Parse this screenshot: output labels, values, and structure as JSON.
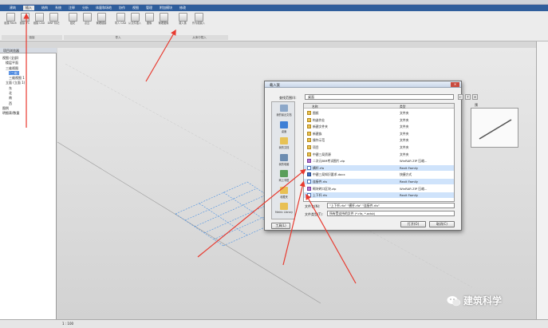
{
  "menubar": {
    "tabs": [
      "建筑",
      "插入",
      "结构",
      "系统",
      "注释",
      "分析",
      "体量和场地",
      "协作",
      "视图",
      "管理",
      "附加模块",
      "修改"
    ],
    "active_index": 1
  },
  "ribbon": {
    "buttons": [
      {
        "label": "链接 Revit"
      },
      {
        "label": "链接 IFC"
      },
      {
        "label": "链接 CAD"
      },
      {
        "label": "DWF 标记"
      },
      {
        "label": "贴花"
      },
      {
        "label": "点云"
      },
      {
        "label": "管理链接"
      },
      {
        "label": "导入 CAD"
      },
      {
        "label": "从文件插入"
      },
      {
        "label": "图像"
      },
      {
        "label": "管理图像"
      },
      {
        "label": "载入族"
      },
      {
        "label": "作为组载入"
      }
    ],
    "groups": [
      "链接",
      "导入",
      "从库中载入"
    ]
  },
  "project_browser": {
    "title": "项目浏览器",
    "items": [
      {
        "label": "视图 (全部)",
        "indent": 0,
        "selected": false
      },
      {
        "label": "楼层平面",
        "indent": 1,
        "selected": false
      },
      {
        "label": "三维视图",
        "indent": 1,
        "selected": false
      },
      {
        "label": "{三维}",
        "indent": 2,
        "selected": true
      },
      {
        "label": "三维视图 1",
        "indent": 2,
        "selected": false
      },
      {
        "label": "立面 (立面 1)",
        "indent": 1,
        "selected": false
      },
      {
        "label": "东",
        "indent": 2,
        "selected": false
      },
      {
        "label": "北",
        "indent": 2,
        "selected": false
      },
      {
        "label": "南",
        "indent": 2,
        "selected": false
      },
      {
        "label": "西",
        "indent": 2,
        "selected": false
      },
      {
        "label": "图例",
        "indent": 0,
        "selected": false
      },
      {
        "label": "明细表/数量",
        "indent": 0,
        "selected": false
      }
    ]
  },
  "statusbar": {
    "scale": "1 : 100"
  },
  "dialog": {
    "title": "载入族",
    "look_in_label": "查找范围(I):",
    "look_in_value": "桌面",
    "column_name": "名称",
    "column_type": "类型",
    "preview_label": "预览",
    "places": [
      "我的最近文档",
      "桌面",
      "我的文档",
      "我的电脑",
      "网上邻居",
      "收藏夹",
      "Metric Library"
    ],
    "files": [
      {
        "name": "图纸",
        "type": "文件夹",
        "icon": "folder",
        "selected": false
      },
      {
        "name": "构造作业",
        "type": "文件夹",
        "icon": "folder",
        "selected": false
      },
      {
        "name": "新建文件夹",
        "type": "文件夹",
        "icon": "folder",
        "selected": false
      },
      {
        "name": "新建族",
        "type": "文件夹",
        "icon": "folder",
        "selected": false
      },
      {
        "name": "操作示范",
        "type": "文件夹",
        "icon": "folder",
        "selected": false
      },
      {
        "name": "项目",
        "type": "文件夹",
        "icon": "folder",
        "selected": false
      },
      {
        "name": "中建三局资源",
        "type": "文件夹",
        "icon": "folder",
        "selected": false
      },
      {
        "name": "二次元BIM考试图片.zip",
        "type": "WinRAR ZIP 压缩...",
        "icon": "zip",
        "selected": false
      },
      {
        "name": "横杆.rfa",
        "type": "Revit Family",
        "icon": "rfa",
        "selected": true
      },
      {
        "name": "中建三局知识要求.docx",
        "type": "快捷方式",
        "icon": "docx",
        "selected": false
      },
      {
        "name": "连接件.rfa",
        "type": "Revit Family",
        "icon": "rfa",
        "selected": true
      },
      {
        "name": "砌块砖口区块.zip",
        "type": "WinRAR ZIP 压缩...",
        "icon": "zip",
        "selected": false
      },
      {
        "name": "上下杆.rfa",
        "type": "Revit Family",
        "icon": "rfa",
        "selected": true
      }
    ],
    "filename_label": "文件名(N):",
    "filename_value": "\"上下杆.rfa\" \"横杆.rfa\" \"连接件.rfa\"",
    "filetype_label": "文件类型(T):",
    "filetype_value": "所有受支持的文件 (*.rfa, *.adsk)",
    "tools_label": "工具(L)",
    "open_label": "打开(O)",
    "cancel_label": "取消(C)"
  },
  "watermark": {
    "text": "建筑科学"
  },
  "colors": {
    "menubar": "#2f5e9c",
    "selection": "#cfe3fb",
    "arrow": "#e83a2f",
    "grid": "#4a90e2"
  }
}
